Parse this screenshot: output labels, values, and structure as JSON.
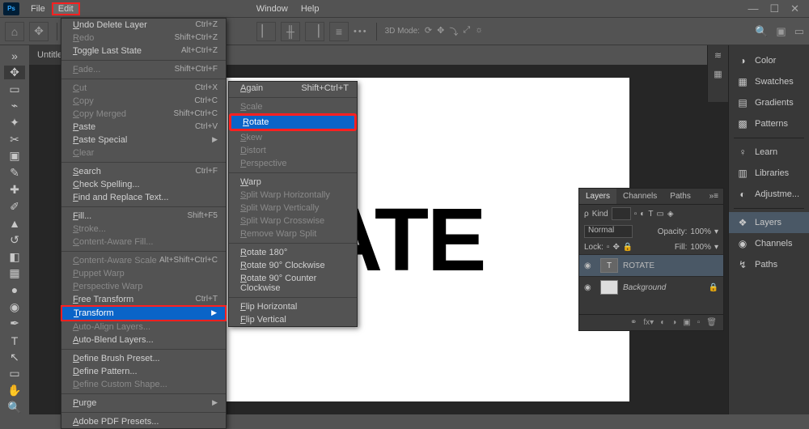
{
  "menubar": {
    "items": [
      "File",
      "Edit"
    ],
    "right_items": [
      "Window",
      "Help"
    ]
  },
  "doc_tab": "Untitled",
  "canvas_text": "TATE",
  "edit_menu": [
    {
      "label": "Undo Delete Layer",
      "shortcut": "Ctrl+Z"
    },
    {
      "label": "Redo",
      "shortcut": "Shift+Ctrl+Z",
      "dim": true
    },
    {
      "label": "Toggle Last State",
      "shortcut": "Alt+Ctrl+Z"
    },
    {
      "divider": true
    },
    {
      "label": "Fade...",
      "shortcut": "Shift+Ctrl+F",
      "dim": true
    },
    {
      "divider": true
    },
    {
      "label": "Cut",
      "shortcut": "Ctrl+X",
      "dim": true
    },
    {
      "label": "Copy",
      "shortcut": "Ctrl+C",
      "dim": true
    },
    {
      "label": "Copy Merged",
      "shortcut": "Shift+Ctrl+C",
      "dim": true
    },
    {
      "label": "Paste",
      "shortcut": "Ctrl+V"
    },
    {
      "label": "Paste Special",
      "submenu": true
    },
    {
      "label": "Clear",
      "dim": true
    },
    {
      "divider": true
    },
    {
      "label": "Search",
      "shortcut": "Ctrl+F"
    },
    {
      "label": "Check Spelling..."
    },
    {
      "label": "Find and Replace Text..."
    },
    {
      "divider": true
    },
    {
      "label": "Fill...",
      "shortcut": "Shift+F5"
    },
    {
      "label": "Stroke...",
      "dim": true
    },
    {
      "label": "Content-Aware Fill...",
      "dim": true
    },
    {
      "divider": true
    },
    {
      "label": "Content-Aware Scale",
      "shortcut": "Alt+Shift+Ctrl+C",
      "dim": true
    },
    {
      "label": "Puppet Warp",
      "dim": true
    },
    {
      "label": "Perspective Warp",
      "dim": true
    },
    {
      "label": "Free Transform",
      "shortcut": "Ctrl+T"
    },
    {
      "label": "Transform",
      "submenu": true,
      "selected": true,
      "redbox": true
    },
    {
      "label": "Auto-Align Layers...",
      "dim": true
    },
    {
      "label": "Auto-Blend Layers..."
    },
    {
      "divider": true
    },
    {
      "label": "Define Brush Preset..."
    },
    {
      "label": "Define Pattern..."
    },
    {
      "label": "Define Custom Shape...",
      "dim": true
    },
    {
      "divider": true
    },
    {
      "label": "Purge",
      "submenu": true
    },
    {
      "divider": true
    },
    {
      "label": "Adobe PDF Presets..."
    }
  ],
  "transform_menu": [
    {
      "label": "Again",
      "shortcut": "Shift+Ctrl+T"
    },
    {
      "divider": true
    },
    {
      "label": "Scale",
      "dim": true
    },
    {
      "label": "Rotate",
      "selected": true,
      "redbox": true
    },
    {
      "label": "Skew",
      "dim": true
    },
    {
      "label": "Distort",
      "dim": true
    },
    {
      "label": "Perspective",
      "dim": true
    },
    {
      "divider": true
    },
    {
      "label": "Warp"
    },
    {
      "label": "Split Warp Horizontally",
      "dim": true
    },
    {
      "label": "Split Warp Vertically",
      "dim": true
    },
    {
      "label": "Split Warp Crosswise",
      "dim": true
    },
    {
      "label": "Remove Warp Split",
      "dim": true
    },
    {
      "divider": true
    },
    {
      "label": "Rotate 180°"
    },
    {
      "label": "Rotate 90° Clockwise"
    },
    {
      "label": "Rotate 90° Counter Clockwise"
    },
    {
      "divider": true
    },
    {
      "label": "Flip Horizontal"
    },
    {
      "label": "Flip Vertical"
    }
  ],
  "right_panels": [
    {
      "icon": "◑",
      "label": "Color"
    },
    {
      "icon": "▦",
      "label": "Swatches"
    },
    {
      "icon": "▤",
      "label": "Gradients"
    },
    {
      "icon": "▩",
      "label": "Patterns"
    },
    {
      "sep": true
    },
    {
      "icon": "♀",
      "label": "Learn"
    },
    {
      "icon": "▥",
      "label": "Libraries"
    },
    {
      "icon": "◐",
      "label": "Adjustme..."
    },
    {
      "sep": true
    },
    {
      "icon": "❖",
      "label": "Layers",
      "active": true
    },
    {
      "icon": "◉",
      "label": "Channels"
    },
    {
      "icon": "↯",
      "label": "Paths"
    }
  ],
  "layers_panel": {
    "tabs": [
      "Layers",
      "Channels",
      "Paths"
    ],
    "kind_label": "Kind",
    "blend_mode": "Normal",
    "opacity_label": "Opacity:",
    "opacity_value": "100%",
    "lock_label": "Lock:",
    "fill_label": "Fill:",
    "fill_value": "100%",
    "layers": [
      {
        "name": "ROTATE",
        "type": "T",
        "active": true
      },
      {
        "name": "Background",
        "type": "bg",
        "locked": true
      }
    ]
  },
  "optbar_mode_label": "3D Mode:"
}
